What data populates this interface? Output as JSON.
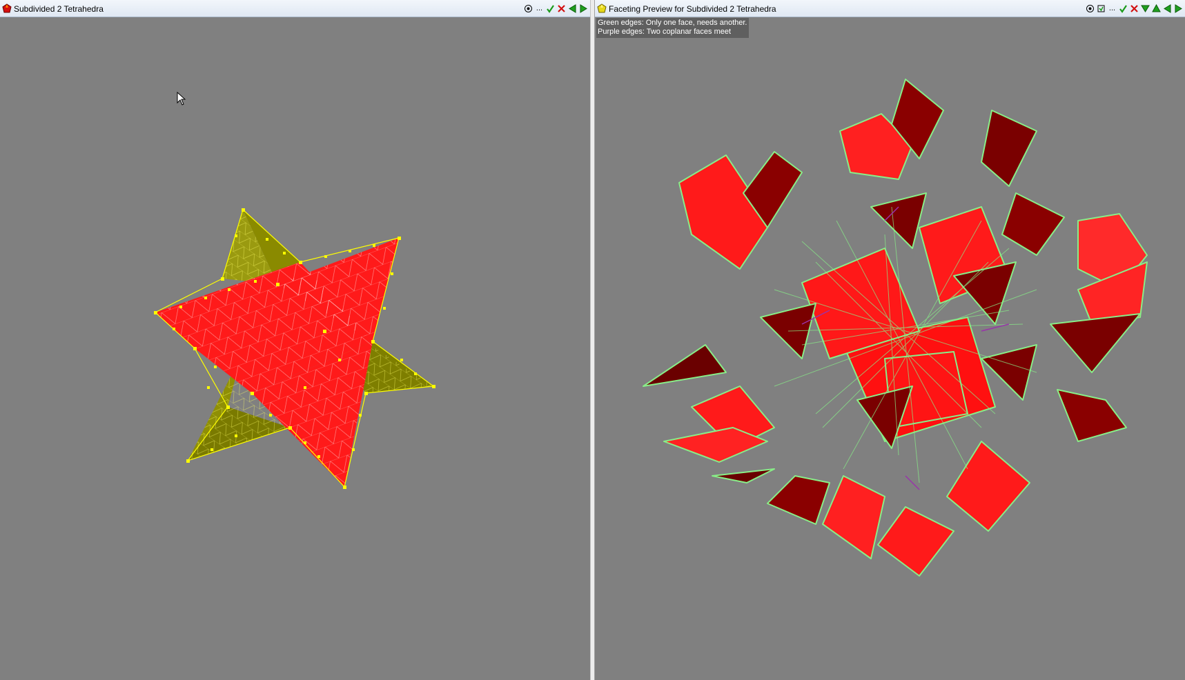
{
  "left_window": {
    "title": "Subdivided 2 Tetrahedra",
    "icon": "red-polyhedron-icon",
    "toolbar": [
      "target-icon",
      "ellipsis-icon",
      "check-icon",
      "close-icon",
      "prev-arrow-icon",
      "next-arrow-icon"
    ]
  },
  "right_window": {
    "title": "Faceting Preview for Subdivided 2 Tetrahedra",
    "icon": "yellow-polyhedron-icon",
    "toolbar": [
      "target-icon",
      "reload-icon",
      "ellipsis-icon",
      "check-icon",
      "close-icon",
      "filter-icon",
      "flag-icon",
      "prev-arrow-icon",
      "next-arrow-icon"
    ],
    "legend": {
      "line1": "Green edges: Only one face, needs another.",
      "line2": "Purple edges: Two coplanar faces meet"
    }
  },
  "toolbar_symbols": {
    "ellipsis": "..."
  },
  "colors": {
    "background": "#808080",
    "face_red": "#ff1a1a",
    "face_dark_red": "#7a0000",
    "face_olive": "#8a8a00",
    "vertex_yellow": "#ffff00",
    "edge_green": "#88ee88",
    "edge_purple": "#9933aa"
  }
}
